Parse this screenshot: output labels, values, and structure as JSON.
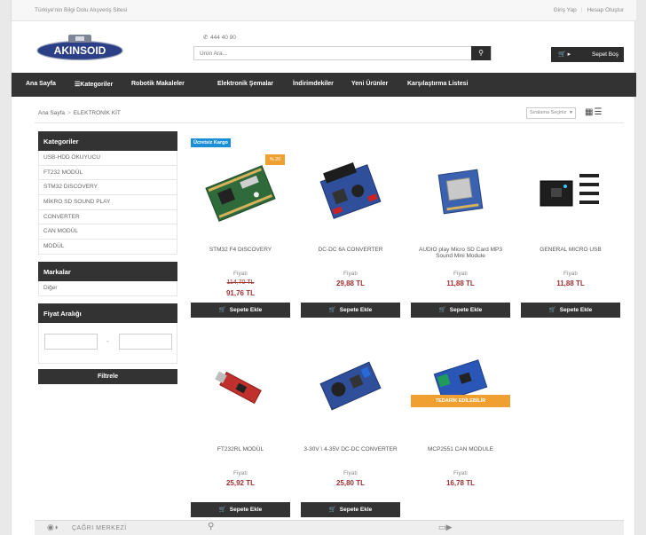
{
  "topbar": {
    "tagline": "Türkiye'nin Bilgi Dolu Alışveriş Sitesi",
    "login": "Giriş Yap",
    "register": "Hesap Oluştur"
  },
  "header": {
    "logo_text": "AKINSOID",
    "phone": "444 40 90",
    "search_placeholder": "Ürün Ara...",
    "cart_label": "Sepet Boş"
  },
  "nav": [
    "Ana Sayfa",
    "Kategoriler",
    "Robotik Makaleler",
    "Elektronik Şemalar",
    "İndirimdekiler",
    "Yeni Ürünler",
    "Karşılaştırma Listesi"
  ],
  "breadcrumb": {
    "home": "Ana Sayfa",
    "arrow": ">",
    "current": "ELEKTRONİK KİT"
  },
  "sort": {
    "label": "Sıralama Seçiniz"
  },
  "sidebar": {
    "categories_title": "Kategoriler",
    "categories": [
      "USB-HDD OKUYUCU",
      "FT232 MODÜL",
      "STM32 DISCOVERY",
      "MİKRO SD SOUND PLAY",
      "CONVERTER",
      "CAN MODÜL",
      "MODÜL"
    ],
    "brands_title": "Markalar",
    "brands": [
      "Diğer"
    ],
    "price_title": "Fiyat Aralığı",
    "price_dash": "-",
    "filter_label": "Filtrele"
  },
  "products": [
    {
      "name": "STM32 F4 DISCOVERY",
      "price_label": "Fiyatı",
      "old_price": "114,70 TL",
      "price": "91,76 TL",
      "button": "Sepete Ekle",
      "badge_cargo": "Ücretsiz Kargo",
      "badge_discount": "% 20"
    },
    {
      "name": "DC-DC 6A CONVERTER",
      "price_label": "Fiyatı",
      "price": "29,88 TL",
      "button": "Sepete Ekle"
    },
    {
      "name": "AUDIO play Micro SD Card MP3 Sound Mini Module",
      "price_label": "Fiyatı",
      "price": "11,88 TL",
      "button": "Sepete Ekle"
    },
    {
      "name": "GENERAL MICRO USB",
      "price_label": "Fiyatı",
      "price": "11,88 TL",
      "button": "Sepete Ekle"
    },
    {
      "name": "FT232RL MODÜL",
      "price_label": "Fiyatı",
      "price": "25,92 TL",
      "button": "Sepete Ekle"
    },
    {
      "name": "3-30V \\ 4-35V DC-DC CONVERTER",
      "price_label": "Fiyatı",
      "price": "25,80 TL",
      "button": "Sepete Ekle"
    },
    {
      "name": "MCP2551 CAN MODULE",
      "price_label": "Fiyatı",
      "price": "16,78 TL",
      "button": "Sepete Ekle",
      "badge_supply": "TEDARİK EDİLEBİLİR"
    }
  ],
  "footer": {
    "call_center": "ÇAĞRI MERKEZİ"
  },
  "colors": {
    "dark": "#333333",
    "price": "#a03030",
    "cargo_badge": "#1a8fd8",
    "orange_badge": "#f0a030"
  }
}
